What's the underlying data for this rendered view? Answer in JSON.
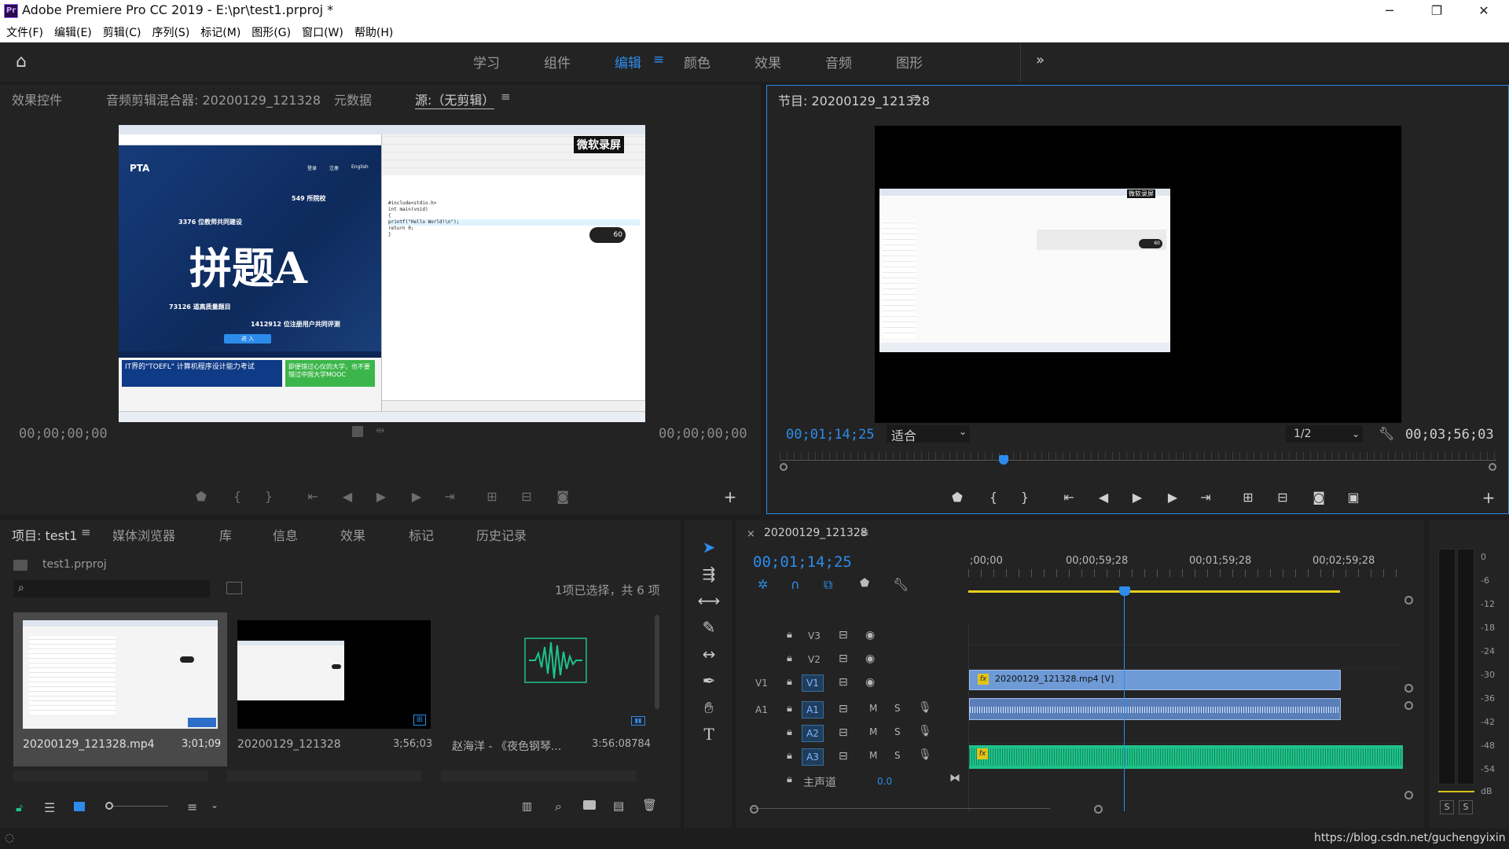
{
  "app": {
    "title": "Adobe Premiere Pro CC 2019 - E:\\pr\\test1.prproj *",
    "logo": "Pr"
  },
  "menu": [
    "文件(F)",
    "编辑(E)",
    "剪辑(C)",
    "序列(S)",
    "标记(M)",
    "图形(G)",
    "窗口(W)",
    "帮助(H)"
  ],
  "workspaces": [
    "学习",
    "组件",
    "编辑",
    "颜色",
    "效果",
    "音频",
    "图形"
  ],
  "workspace_active": "编辑",
  "source_panel": {
    "tabs": [
      "效果控件",
      "音频剪辑混合器: 20200129_121328",
      "元数据",
      "源:（无剪辑）"
    ],
    "tc_left": "00;00;00;00",
    "tc_right": "00;00;00;00"
  },
  "program_panel": {
    "title": "节目: 20200129_121328",
    "tc_current": "00;01;14;25",
    "fit": "适合",
    "resolution": "1/2",
    "tc_duration": "00;03;56;03",
    "playhead_fraction": 0.313
  },
  "preview_content": {
    "watermark": "微软录屏",
    "pta_logo": "PTA",
    "pta_nav": [
      "登录",
      "注册",
      "English"
    ],
    "stats": [
      "549 所院校",
      "3376 位教师共同建设",
      "73126 道高质量题目",
      "1412912 位注册用户共同评测"
    ],
    "slogan": "拼题A",
    "enter": "进 入",
    "banner1": "IT界的\"TOEFL\" 计算机程序设计能力考试",
    "banner2": "即便错过心仪的大学，也不要错过中国大学MOOC",
    "code": [
      "#include<stdio.h>",
      "int main(void)",
      "{",
      "    printf(\"Hello World!\\n\");",
      "    return 0;",
      "}"
    ],
    "badge": "60"
  },
  "project_panel": {
    "tabs": [
      "项目: test1",
      "媒体浏览器",
      "库",
      "信息",
      "效果",
      "标记",
      "历史记录"
    ],
    "file": "test1.prproj",
    "selection_info": "1项已选择，共 6 项",
    "items": [
      {
        "name": "20200129_121328.mp4",
        "duration": "3;01;09"
      },
      {
        "name": "20200129_121328",
        "duration": "3;56;03"
      },
      {
        "name": "赵海洋 - 《夜色钢琴...",
        "duration": "3:56:08784"
      }
    ]
  },
  "timeline": {
    "tab": "20200129_121328",
    "tc_current": "00;01;14;25",
    "ruler": [
      ";00;00",
      "00;00;59;28",
      "00;01;59;28",
      "00;02;59;28"
    ],
    "tracks": [
      {
        "id": "V3",
        "type": "video"
      },
      {
        "id": "V2",
        "type": "video"
      },
      {
        "id": "V1",
        "type": "video",
        "src": "V1"
      },
      {
        "id": "A1",
        "type": "audio",
        "src": "A1"
      },
      {
        "id": "A2",
        "type": "audio"
      },
      {
        "id": "A3",
        "type": "audio"
      }
    ],
    "master_label": "主声道",
    "master_value": "0.0",
    "clip_video": "20200129_121328.mp4 [V]",
    "clip_fx": "fx",
    "mute": "M",
    "solo": "S"
  },
  "meters": {
    "scale": [
      "0",
      "-6",
      "-12",
      "-18",
      "-24",
      "-30",
      "-36",
      "-42",
      "-48",
      "-54",
      "dB"
    ],
    "buttons": [
      "S",
      "S"
    ]
  },
  "watermark_url": "https://blog.csdn.net/guchengyixin",
  "colors": {
    "accent": "#2d8ceb",
    "audio_green": "#1fc28a",
    "clip_blue": "#6e9ad6"
  }
}
